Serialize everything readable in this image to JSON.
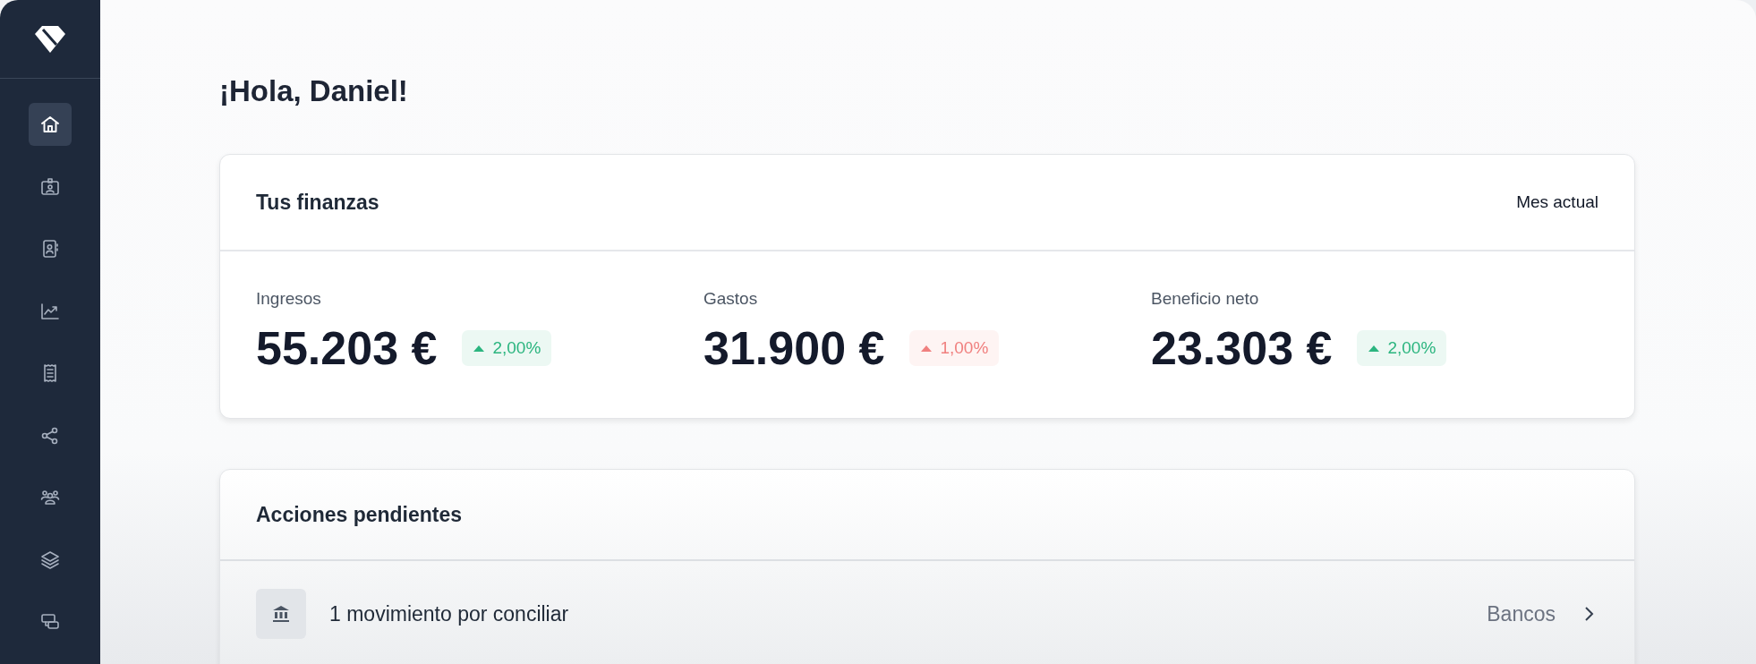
{
  "sidebar": {
    "items": [
      {
        "selected": true
      },
      {
        "selected": false
      },
      {
        "selected": false
      },
      {
        "selected": false
      },
      {
        "selected": false
      },
      {
        "selected": false
      },
      {
        "selected": false
      },
      {
        "selected": false
      },
      {
        "selected": false
      }
    ]
  },
  "greeting": "¡Hola, Daniel!",
  "finances": {
    "title": "Tus finanzas",
    "period": "Mes actual",
    "stats": [
      {
        "label": "Ingresos",
        "value": "55.203 €",
        "change": "2,00%",
        "color": "#2bb57f"
      },
      {
        "label": "Gastos",
        "value": "31.900 €",
        "change": "1,00%",
        "color": "#f0807f"
      },
      {
        "label": "Beneficio neto",
        "value": "23.303 €",
        "change": "2,00%",
        "color": "#2bb57f"
      }
    ]
  },
  "pending": {
    "title": "Acciones pendientes",
    "items": [
      {
        "text": "1 movimiento por conciliar",
        "link": "Bancos"
      }
    ]
  }
}
